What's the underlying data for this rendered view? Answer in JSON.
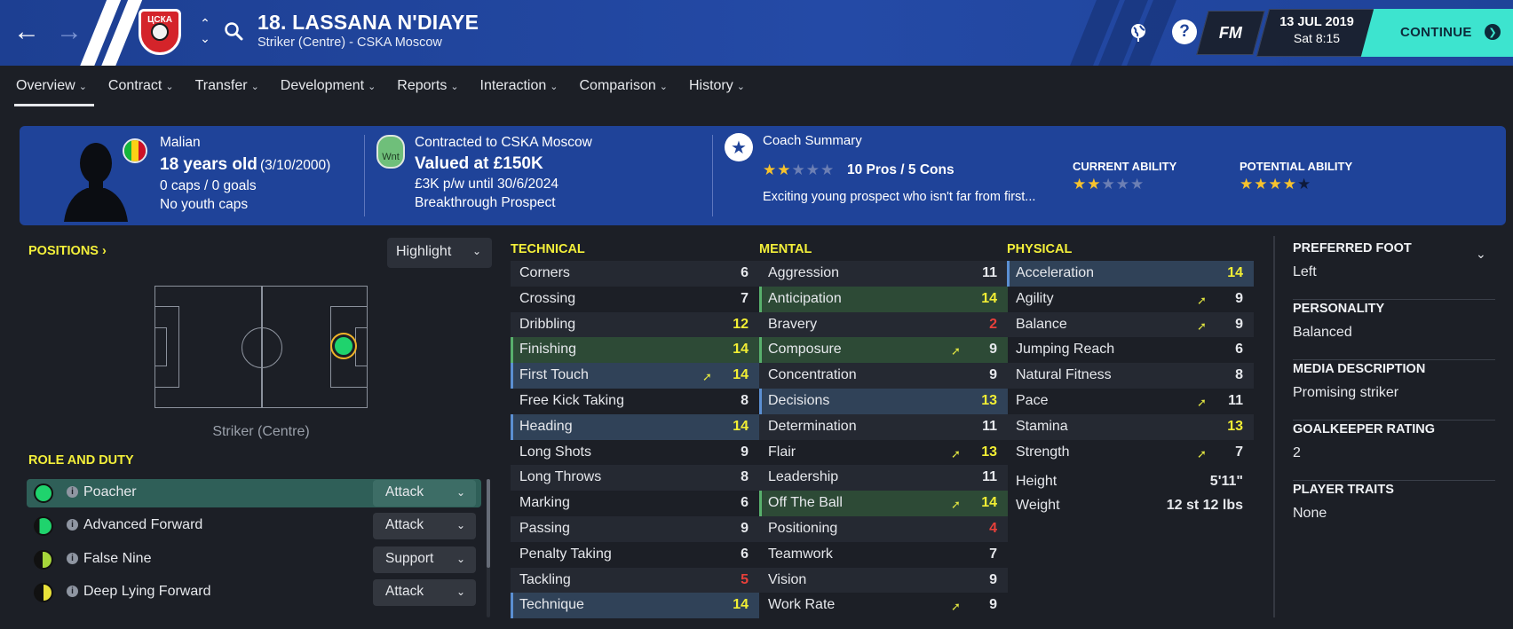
{
  "header": {
    "player_title": "18. LASSANA N'DIAYE",
    "player_subtitle": "Striker (Centre) - CSKA Moscow",
    "club_badge_text": "ЦСКА",
    "fm_label": "FM",
    "date": "13 JUL 2019",
    "time": "Sat 8:15",
    "continue_label": "CONTINUE",
    "icons": [
      "back-arrow-icon",
      "forward-arrow-icon",
      "chevron-up-icon",
      "chevron-down-icon",
      "search-icon",
      "globe-icon",
      "help-icon",
      "continue-icon"
    ]
  },
  "tabs": [
    {
      "label": "Overview",
      "active": true
    },
    {
      "label": "Contract"
    },
    {
      "label": "Transfer"
    },
    {
      "label": "Development"
    },
    {
      "label": "Reports"
    },
    {
      "label": "Interaction"
    },
    {
      "label": "Comparison"
    },
    {
      "label": "History"
    }
  ],
  "summary": {
    "nationality": "Malian",
    "age": "18 years old",
    "dob": "(3/10/2000)",
    "caps": "0 caps / 0 goals",
    "youth_caps": "No youth caps",
    "contract_club": "Contracted to CSKA Moscow",
    "value": "Valued at £150K",
    "wage": "£3K p/w until 30/6/2024",
    "status": "Breakthrough Prospect",
    "wnt_label": "Wnt",
    "coach_title": "Coach Summary",
    "pros_cons": "10 Pros / 5 Cons",
    "coach_rating_stars": 2,
    "coach_text": "Exciting young prospect who isn't far from first...",
    "current_ability_label": "CURRENT ABILITY",
    "current_ability_stars": 2,
    "potential_ability_label": "POTENTIAL ABILITY",
    "potential_ability_stars": 4,
    "flag_colors": [
      "#14b53a",
      "#fcd116",
      "#ce1126"
    ]
  },
  "positions": {
    "title": "POSITIONS",
    "highlight_label": "Highlight",
    "position_label": "Striker (Centre)"
  },
  "roles": {
    "title": "ROLE AND DUTY",
    "items": [
      {
        "name": "Poacher",
        "duty": "Attack",
        "selected": true
      },
      {
        "name": "Advanced Forward",
        "duty": "Attack"
      },
      {
        "name": "False Nine",
        "duty": "Support"
      },
      {
        "name": "Deep Lying Forward",
        "duty": "Attack"
      }
    ]
  },
  "technical": {
    "title": "TECHNICAL",
    "items": [
      {
        "name": "Corners",
        "value": "6"
      },
      {
        "name": "Crossing",
        "value": "7"
      },
      {
        "name": "Dribbling",
        "value": "12"
      },
      {
        "name": "Finishing",
        "value": "14"
      },
      {
        "name": "First Touch",
        "value": "14"
      },
      {
        "name": "Free Kick Taking",
        "value": "8"
      },
      {
        "name": "Heading",
        "value": "14"
      },
      {
        "name": "Long Shots",
        "value": "9"
      },
      {
        "name": "Long Throws",
        "value": "8"
      },
      {
        "name": "Marking",
        "value": "6"
      },
      {
        "name": "Passing",
        "value": "9"
      },
      {
        "name": "Penalty Taking",
        "value": "6"
      },
      {
        "name": "Tackling",
        "value": "5"
      },
      {
        "name": "Technique",
        "value": "14"
      }
    ]
  },
  "mental": {
    "title": "MENTAL",
    "items": [
      {
        "name": "Aggression",
        "value": "11"
      },
      {
        "name": "Anticipation",
        "value": "14"
      },
      {
        "name": "Bravery",
        "value": "2"
      },
      {
        "name": "Composure",
        "value": "9"
      },
      {
        "name": "Concentration",
        "value": "9"
      },
      {
        "name": "Decisions",
        "value": "13"
      },
      {
        "name": "Determination",
        "value": "11"
      },
      {
        "name": "Flair",
        "value": "13"
      },
      {
        "name": "Leadership",
        "value": "11"
      },
      {
        "name": "Off The Ball",
        "value": "14"
      },
      {
        "name": "Positioning",
        "value": "4"
      },
      {
        "name": "Teamwork",
        "value": "7"
      },
      {
        "name": "Vision",
        "value": "9"
      },
      {
        "name": "Work Rate",
        "value": "9"
      }
    ]
  },
  "physical": {
    "title": "PHYSICAL",
    "items": [
      {
        "name": "Acceleration",
        "value": "14"
      },
      {
        "name": "Agility",
        "value": "9"
      },
      {
        "name": "Balance",
        "value": "9"
      },
      {
        "name": "Jumping Reach",
        "value": "6"
      },
      {
        "name": "Natural Fitness",
        "value": "8"
      },
      {
        "name": "Pace",
        "value": "11"
      },
      {
        "name": "Stamina",
        "value": "13"
      },
      {
        "name": "Strength",
        "value": "7"
      }
    ],
    "height_label": "Height",
    "height_value": "5'11\"",
    "weight_label": "Weight",
    "weight_value": "12 st 12 lbs"
  },
  "info": [
    {
      "title": "PREFERRED FOOT",
      "value": "Left"
    },
    {
      "title": "PERSONALITY",
      "value": "Balanced"
    },
    {
      "title": "MEDIA DESCRIPTION",
      "value": "Promising striker"
    },
    {
      "title": "GOALKEEPER RATING",
      "value": "2"
    },
    {
      "title": "PLAYER TRAITS",
      "value": "None"
    }
  ],
  "colors": {
    "header_blue": "#1f4399",
    "continue_teal": "#3de4cf",
    "section_yellow": "#f3ef3a",
    "high_value": "#f2ee34",
    "low_value": "#e8403a",
    "key_green": "#2d4a36",
    "key_blue": "#304258"
  }
}
